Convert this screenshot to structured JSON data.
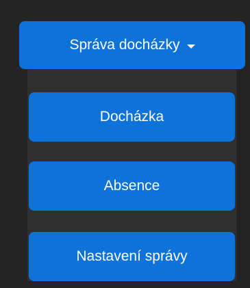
{
  "dropdown": {
    "toggle_label": "Správa docházky",
    "caret_icon": "caret-down-icon",
    "items": [
      {
        "label": "Docházka"
      },
      {
        "label": "Absence"
      },
      {
        "label": "Nastavení správy"
      }
    ]
  },
  "colors": {
    "background": "#242424",
    "panel": "#2f2f2f",
    "button": "#0d73da",
    "text": "#ffffff"
  }
}
